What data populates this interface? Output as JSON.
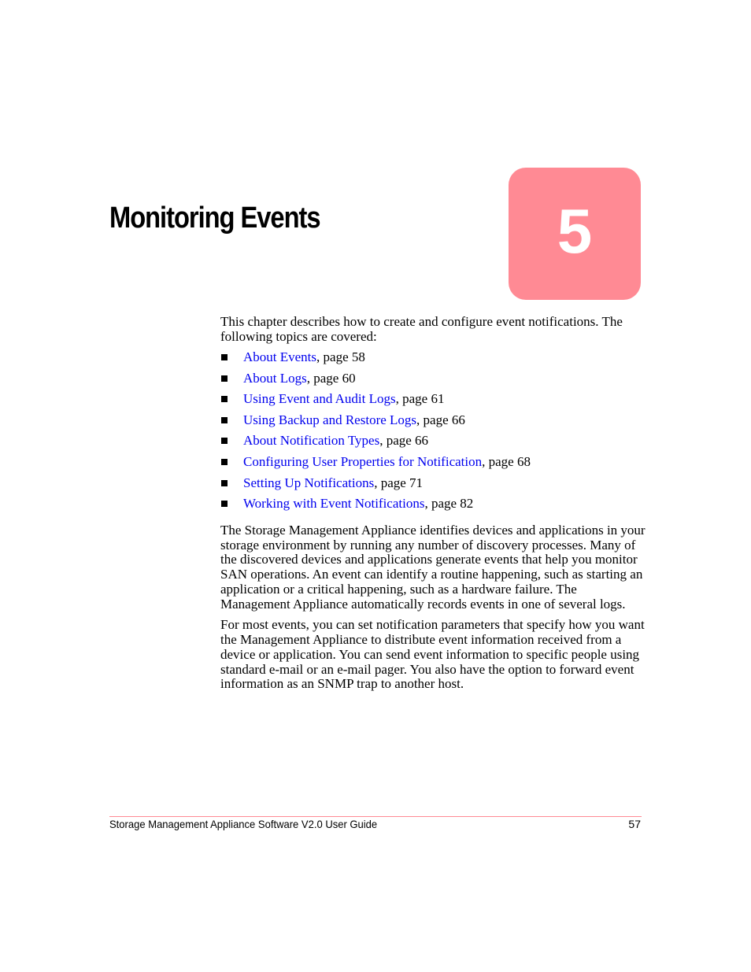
{
  "chapter": {
    "title": "Monitoring Events",
    "number": "5",
    "accent_color": "#ff8a94"
  },
  "intro": "This chapter describes how to create and configure event notifications. The following topics are covered:",
  "topics": [
    {
      "link": "About Events",
      "page": ", page 58"
    },
    {
      "link": "About Logs",
      "page": ", page 60"
    },
    {
      "link": "Using Event and Audit Logs",
      "page": ", page 61"
    },
    {
      "link": "Using Backup and Restore Logs",
      "page": ", page 66"
    },
    {
      "link": "About Notification Types",
      "page": ", page 66"
    },
    {
      "link": "Configuring User Properties for Notification",
      "page": ", page 68"
    },
    {
      "link": "Setting Up Notifications",
      "page": ", page 71"
    },
    {
      "link": "Working with Event Notifications",
      "page": ", page 82"
    }
  ],
  "paragraphs": [
    "The Storage Management Appliance identifies devices and applications in your storage environment by running any number of discovery processes. Many of the discovered devices and applications generate events that help you monitor SAN operations. An event can identify a routine happening, such as starting an application or a critical happening, such as a hardware failure. The Management Appliance automatically records events in one of several logs.",
    "For most events, you can set notification parameters that specify how you want the Management Appliance to distribute event information received from a device or application. You can send event information to specific people using standard e-mail or an e-mail pager. You also have the option to forward event information as an SNMP trap to another host."
  ],
  "footer": {
    "title": "Storage Management Appliance Software V2.0 User Guide",
    "page_number": "57"
  }
}
